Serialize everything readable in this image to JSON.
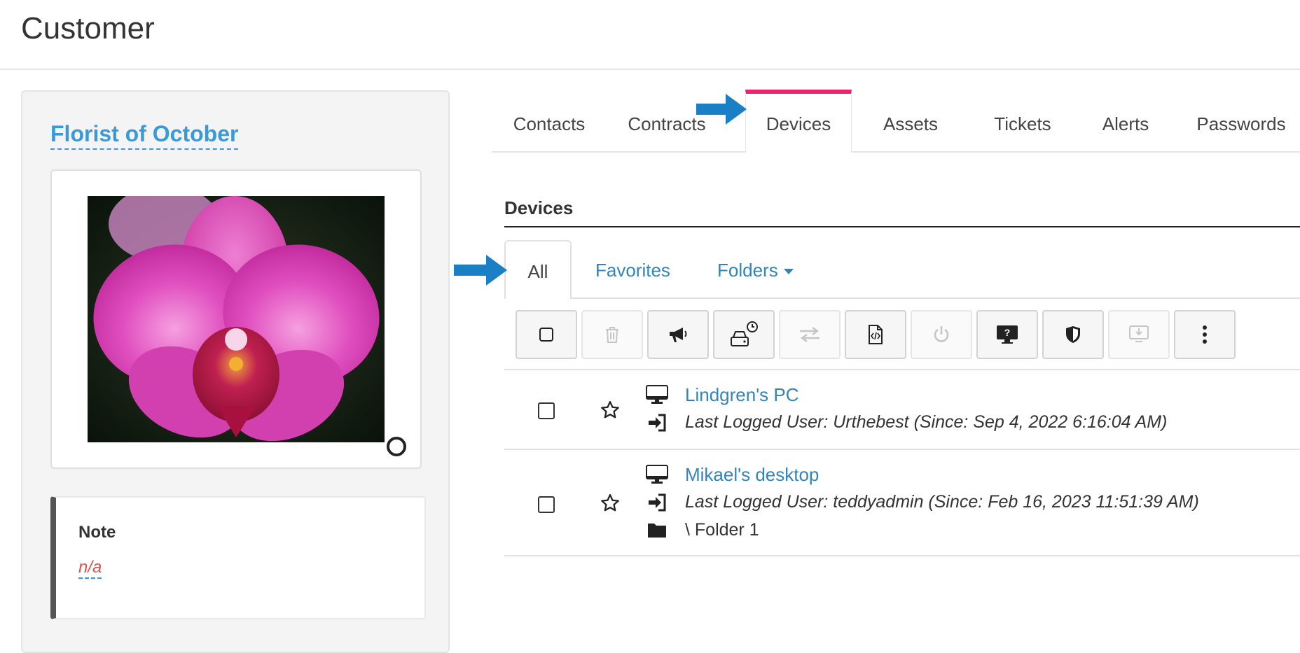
{
  "page": {
    "title": "Customer"
  },
  "customer": {
    "name": "Florist of October",
    "note": {
      "title": "Note",
      "value": "n/a"
    }
  },
  "tabs": [
    {
      "label": "Contacts",
      "active": false
    },
    {
      "label": "Contracts",
      "active": false
    },
    {
      "label": "Devices",
      "active": true
    },
    {
      "label": "Assets",
      "active": false
    },
    {
      "label": "Tickets",
      "active": false
    },
    {
      "label": "Alerts",
      "active": false
    },
    {
      "label": "Passwords",
      "active": false
    }
  ],
  "devices_section": {
    "title": "Devices",
    "subtabs": {
      "all": "All",
      "favorites": "Favorites",
      "folders": "Folders"
    },
    "toolbar": [
      {
        "icon": "checkbox-icon",
        "disabled": false
      },
      {
        "icon": "trash-icon",
        "disabled": true
      },
      {
        "icon": "megaphone-icon",
        "disabled": false
      },
      {
        "icon": "drive-clock-icon",
        "disabled": false
      },
      {
        "icon": "transfer-arrows-icon",
        "disabled": true
      },
      {
        "icon": "file-code-icon",
        "disabled": false
      },
      {
        "icon": "power-icon",
        "disabled": true
      },
      {
        "icon": "monitor-question-icon",
        "disabled": false
      },
      {
        "icon": "shield-icon",
        "disabled": false
      },
      {
        "icon": "download-monitor-icon",
        "disabled": true
      },
      {
        "icon": "more-vertical-icon",
        "disabled": false
      }
    ],
    "devices": [
      {
        "name": "Lindgren's PC",
        "last_user": "Last Logged User: Urthebest (Since: Sep 4, 2022 6:16:04 AM)"
      },
      {
        "name": "Mikael's desktop",
        "last_user": "Last Logged User: teddyadmin (Since: Feb 16, 2023 11:51:39 AM)",
        "folder": "\\ Folder 1"
      }
    ]
  },
  "colors": {
    "accent": "#e8246c",
    "link": "#3584b8",
    "customer_name": "#3a9ad9",
    "note_value": "#d9534f",
    "annotation_arrow": "#1a7fc4"
  }
}
